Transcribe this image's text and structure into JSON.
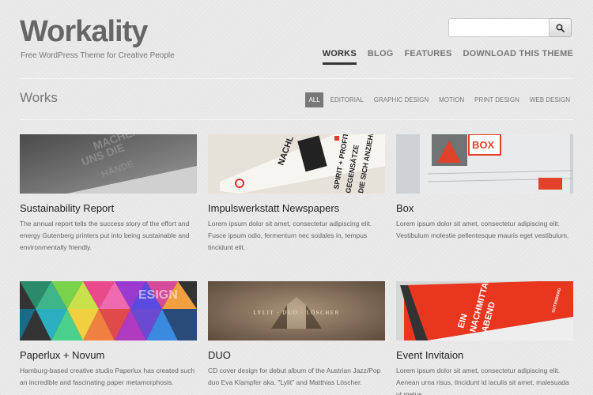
{
  "site": {
    "title": "Workality",
    "tagline": "Free WordPress Theme for Creative People"
  },
  "search": {
    "placeholder": "",
    "icon": "magnifier-icon"
  },
  "nav": [
    {
      "label": "WORKS",
      "active": true
    },
    {
      "label": "BLOG",
      "active": false
    },
    {
      "label": "FEATURES",
      "active": false
    },
    {
      "label": "DOWNLOAD THIS THEME",
      "active": false
    }
  ],
  "section": {
    "title": "Works"
  },
  "filters": [
    {
      "label": "ALL",
      "active": true
    },
    {
      "label": "EDITORIAL",
      "active": false
    },
    {
      "label": "GRAPHIC DESIGN",
      "active": false
    },
    {
      "label": "MOTION",
      "active": false
    },
    {
      "label": "PRINT DESIGN",
      "active": false
    },
    {
      "label": "WEB DESIGN",
      "active": false
    }
  ],
  "works": [
    {
      "title": "Sustainability Report",
      "description": "The annual report tells the success story of the effort and energy Gutenberg printers put into being sustainable and environmentally friendly.",
      "thumb_text": "MACHEN UNS DIE HÄNDE SCHMUTZIG"
    },
    {
      "title": "Impulswerkstatt Newspapers",
      "description": "Lorem ipsum dolor sit amet, consectetur adipiscing elit. Fusce ipsum odio, fermentum nec sodales in, tempus tincidunt elit.",
      "thumb_text": "NACHL SPIRIT + PROFIT GEGENSÄTZE DIE SICH ANZIEHEN"
    },
    {
      "title": "Box",
      "description": "Lorem ipsum dolor sit amet, consectetur adipiscing elit. Vestibulum molestie pellentesque mauris eget vestibulum.",
      "thumb_text": "BOX"
    },
    {
      "title": "Paperlux + Novum",
      "description": "Hamburg-based creative studio Paperlux has created such an incredible and fascinating paper metamorphosis.",
      "thumb_text": "ESIGN"
    },
    {
      "title": "DUO",
      "description": "CD cover design for debut album of the Austrian Jazz/Pop duo Eva Klampfer aka. \"Lylit\" and Matthias Löscher.",
      "thumb_text": "LYLIT · DUO · LÖSCHER"
    },
    {
      "title": "Event Invitaion",
      "description": "Lorem ipsum dolor sit amet, consectetur adipiscing elit. Aenean urna risus, tincidunt id iaculis sit amet, malesuada ut metus.",
      "thumb_text": "EIN NACHMITTAG ABEND GUTENBERG"
    }
  ]
}
